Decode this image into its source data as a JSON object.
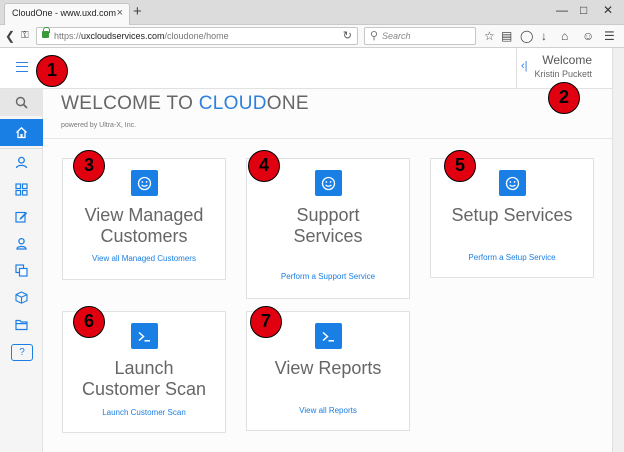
{
  "browser": {
    "tab_title": "CloudOne - www.uxd.com",
    "tab_close": "×",
    "new_tab": "+",
    "url_scheme": "https://",
    "url_host": "uxcloudservices.com",
    "url_path": "/cloudone/home",
    "search_placeholder": "Search"
  },
  "header": {
    "welcome_label": "Welcome",
    "user_name": "Kristin Puckett"
  },
  "main": {
    "title_prefix": "WELCOME TO ",
    "title_brand": "CLOUD",
    "title_suffix": "ONE",
    "powered_by": "powered by Ultra-X, Inc."
  },
  "cards": {
    "managed": {
      "title_line1": "View Managed",
      "title_line2": "Customers",
      "link": "View all Managed Customers"
    },
    "support": {
      "title_line1": "Support",
      "title_line2": "Services",
      "link": "Perform a Support Service"
    },
    "setup": {
      "title_line1": "Setup Services",
      "link": "Perform a Setup Service"
    },
    "scan": {
      "title_line1": "Launch",
      "title_line2": "Customer Scan",
      "link": "Launch Customer Scan"
    },
    "reports": {
      "title_line1": "View Reports",
      "link": "View all Reports"
    }
  },
  "sidebar": {
    "help_label": "?"
  },
  "callouts": [
    "1",
    "2",
    "3",
    "4",
    "5",
    "6",
    "7"
  ],
  "colors": {
    "accent": "#1a7fe5",
    "callout": "#e1000f"
  }
}
